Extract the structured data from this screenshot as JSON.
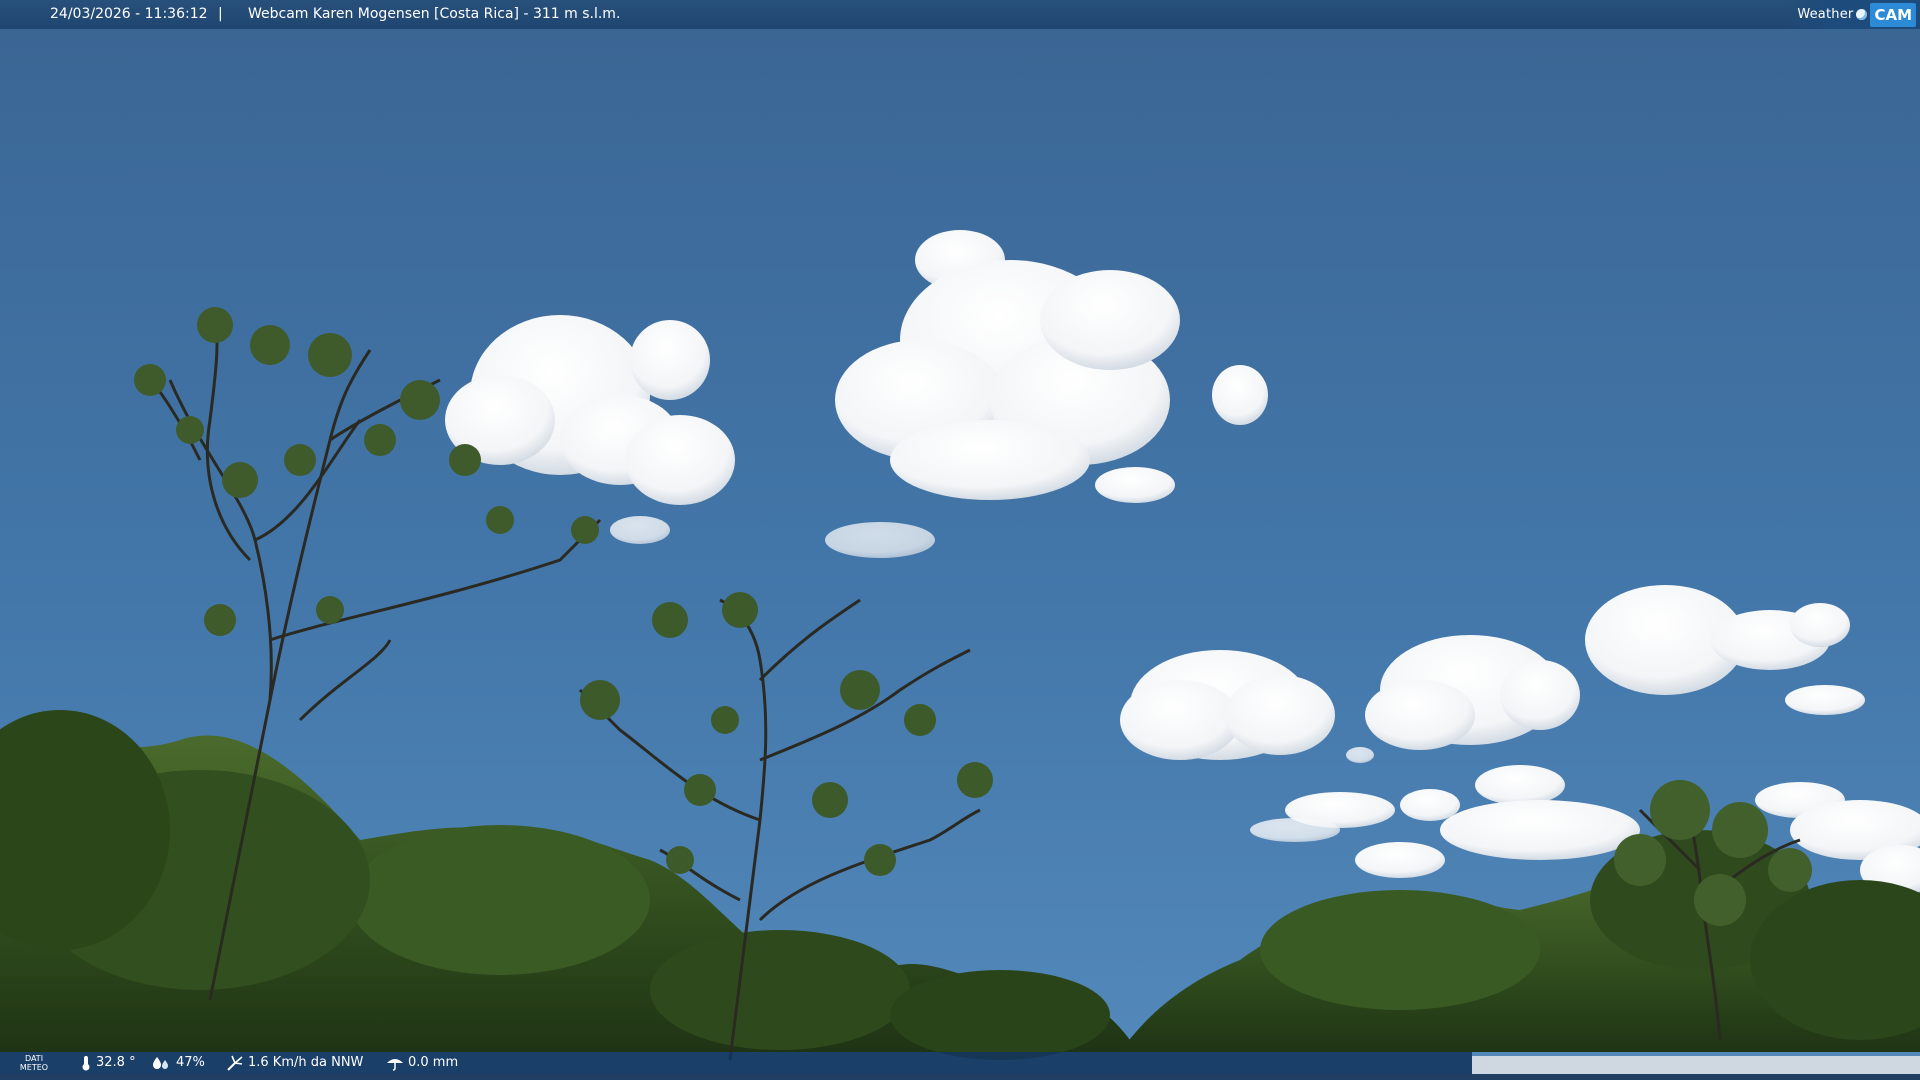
{
  "header": {
    "timestamp": "24/03/2026 - 11:36:12",
    "separator": "|",
    "title": "Webcam Karen Mogensen [Costa Rica]  - 311 m s.l.m."
  },
  "logo": {
    "weather": "Weather",
    "cam": "CAM"
  },
  "footer": {
    "dati_line1": "DATI",
    "dati_line2": "METEO",
    "temperature": "32.8 °",
    "humidity": "47%",
    "wind": "1.6 Km/h da NNW",
    "rain": "0.0 mm"
  },
  "icons": {
    "temperature": "thermometer-icon",
    "humidity": "humidity-icon",
    "wind": "wind-icon",
    "rain": "rain-icon"
  },
  "colors": {
    "sky_top": "#3c6a98",
    "sky_bottom": "#4f85b7",
    "bar": "#1f4671",
    "foliage": "#2f4a1f"
  }
}
